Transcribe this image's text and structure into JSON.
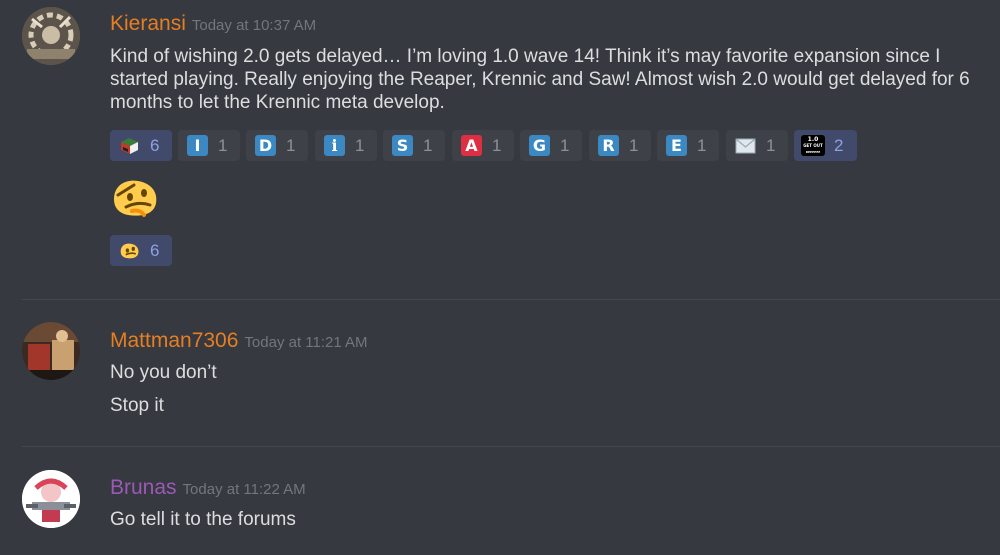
{
  "messages": [
    {
      "username": "Kieransi",
      "username_color": "#e67e22",
      "timestamp": "Today at 10:37 AM",
      "text": "Kind of wishing 2.0 gets delayed… I’m loving 1.0 wave 14! Think it’s may favorite expansion since I started playing. Really enjoying the Reaper, Krennic and Saw! Almost wish 2.0 would get delayed for 6 months to let the Krennic meta develop.",
      "reactions": [
        {
          "icon": "cube-box-icon",
          "count": "6",
          "me": true
        },
        {
          "letter": "I",
          "icon": "regional-indicator-i",
          "count": "1",
          "color": "#3b88c3"
        },
        {
          "letter": "D",
          "icon": "regional-indicator-d",
          "count": "1",
          "color": "#3b88c3"
        },
        {
          "letter": "i",
          "icon": "information-source-icon",
          "count": "1",
          "color": "#3b88c3"
        },
        {
          "letter": "S",
          "icon": "regional-indicator-s",
          "count": "1",
          "color": "#3b88c3"
        },
        {
          "letter": "A",
          "icon": "a-button-icon",
          "count": "1",
          "color": "#dd2e44"
        },
        {
          "letter": "G",
          "icon": "regional-indicator-g",
          "count": "1",
          "color": "#3b88c3"
        },
        {
          "letter": "R",
          "icon": "regional-indicator-r",
          "count": "1",
          "color": "#3b88c3"
        },
        {
          "letter": "E",
          "icon": "regional-indicator-e",
          "count": "1",
          "color": "#3b88c3"
        },
        {
          "icon": "envelope-icon",
          "count": "1"
        },
        {
          "icon": "get-out-reeeee-icon",
          "count": "2",
          "me": true,
          "emoji_text": [
            "1.0",
            "GET OUT",
            "REEEEEE"
          ]
        }
      ],
      "big_emoji": "thinking-blob-icon",
      "emoji_reaction": {
        "icon": "thinking-blob-icon",
        "count": "6",
        "me": true
      }
    },
    {
      "username": "Mattman7306",
      "username_color": "#e67e22",
      "timestamp": "Today at 11:21 AM",
      "lines": [
        "No you don’t",
        "Stop it"
      ]
    },
    {
      "username": "Brunas",
      "username_color": "#9b59b6",
      "timestamp": "Today at 11:22 AM",
      "lines": [
        "Go tell it to the forums"
      ]
    }
  ]
}
